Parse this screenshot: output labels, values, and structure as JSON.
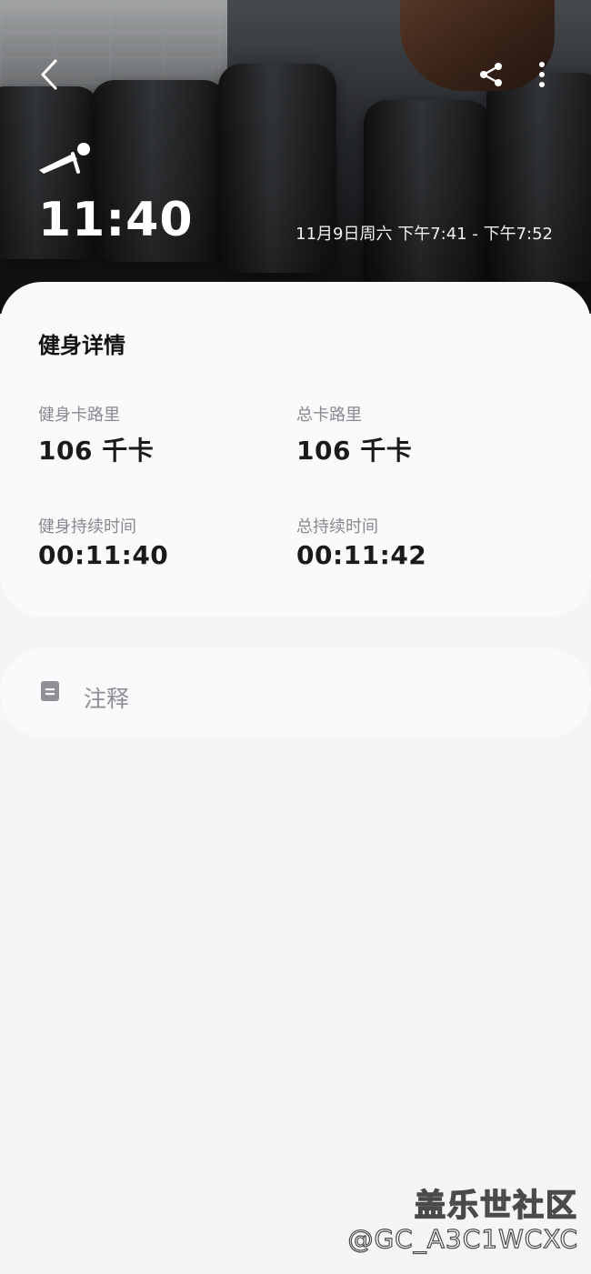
{
  "header": {
    "duration": "11:40",
    "time_range": "11月9日周六 下午7:41 - 下午7:52",
    "icons": {
      "back": "chevron-left-icon",
      "share": "share-icon",
      "more": "more-vertical-icon",
      "activity": "workout-activity-icon"
    }
  },
  "details": {
    "title": "健身详情",
    "workout_calories": {
      "label": "健身卡路里",
      "value": "106 千卡"
    },
    "total_calories": {
      "label": "总卡路里",
      "value": "106 千卡"
    },
    "workout_duration": {
      "label": "健身持续时间",
      "value": "00:11:40"
    },
    "total_duration": {
      "label": "总持续时间",
      "value": "00:11:42"
    }
  },
  "notes": {
    "label": "注释",
    "icon": "note-icon"
  },
  "watermark": {
    "title": "盖乐世社区",
    "handle": "@GC_A3C1WCXC"
  },
  "colors": {
    "background": "#f5f5f7",
    "card": "#fafafc",
    "label": "#8a8a8e",
    "value": "#1a1a1a"
  }
}
